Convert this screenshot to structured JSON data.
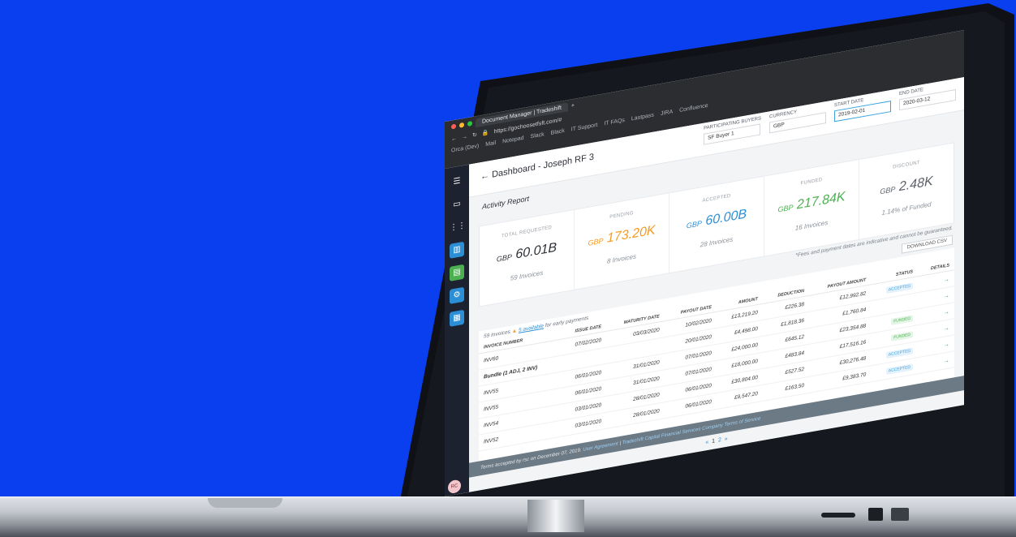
{
  "browser": {
    "tab_title": "Document Manager | Tradeshift",
    "url": "https://gochoosetfsft.com/#",
    "bookmarks": [
      "Orca (Dev)",
      "Mail",
      "Notepad",
      "Slack",
      "Black",
      "IT Support",
      "IT FAQs",
      "Lastpass",
      "JIRA",
      "Confluence"
    ]
  },
  "header": {
    "back_arrow": "←",
    "title": "Dashboard - Joseph RF 3",
    "filters": [
      {
        "label": "PARTICIPATING BUYERS",
        "value": "SF Buyer 1"
      },
      {
        "label": "CURRENCY",
        "value": "GBP"
      },
      {
        "label": "START DATE",
        "value": "2019-02-01"
      },
      {
        "label": "END DATE",
        "value": "2020-03-12"
      }
    ]
  },
  "section_title": "Activity Report",
  "cards": [
    {
      "label": "TOTAL REQUESTED",
      "currency": "GBP",
      "amount": "60.01B",
      "count": "59 Invoices",
      "color": "#2d3038"
    },
    {
      "label": "PENDING",
      "currency": "GBP",
      "amount": "173.20K",
      "count": "8 Invoices",
      "color": "#f59a23"
    },
    {
      "label": "ACCEPTED",
      "currency": "GBP",
      "amount": "60.00B",
      "count": "28 Invoices",
      "color": "#2c8fd6"
    },
    {
      "label": "FUNDED",
      "currency": "GBP",
      "amount": "217.84K",
      "count": "16 Invoices",
      "color": "#4caf50"
    },
    {
      "label": "DISCOUNT",
      "currency": "GBP",
      "amount": "2.48K",
      "count": "1.14% of Funded",
      "color": "#5b6068"
    }
  ],
  "note": "*Fees and payment dates are indicative and cannot be guaranteed.",
  "download_label": "DOWNLOAD CSV",
  "table": {
    "info_count": "59 Invoices",
    "info_link": "5 available",
    "info_suffix": "for early payments",
    "columns": [
      "INVOICE NUMBER",
      "ISSUE DATE",
      "MATURITY DATE",
      "PAYOUT DATE",
      "AMOUNT",
      "DEDUCTION",
      "PAYOUT AMOUNT",
      "STATUS",
      "DETAILS"
    ],
    "rows": [
      {
        "inv": "INV60",
        "issue": "07/02/2020",
        "maturity": "03/03/2020",
        "payout": "10/02/2020",
        "amount": "£13,219.20",
        "deduction": "£226.38",
        "payout_amount": "£12,992.82",
        "status": "ACCEPTED",
        "status_kind": "acc"
      },
      {
        "inv": "Bundle (1 ADJ, 2 INV)",
        "issue": "",
        "maturity": "",
        "payout": "20/01/2020",
        "amount": "£4,498.00",
        "deduction": "£1,818.36",
        "payout_amount": "£1,760.84",
        "status": "",
        "status_kind": ""
      },
      {
        "inv": "INV55",
        "issue": "06/01/2020",
        "maturity": "31/01/2020",
        "payout": "07/01/2020",
        "amount": "£24,000.00",
        "deduction": "£645.12",
        "payout_amount": "£23,354.88",
        "status": "FUNDED",
        "status_kind": "fun"
      },
      {
        "inv": "INV55",
        "issue": "06/01/2020",
        "maturity": "31/01/2020",
        "payout": "07/01/2020",
        "amount": "£18,000.00",
        "deduction": "£483.84",
        "payout_amount": "£17,516.16",
        "status": "FUNDED",
        "status_kind": "fun"
      },
      {
        "inv": "INV54",
        "issue": "03/01/2020",
        "maturity": "28/01/2020",
        "payout": "06/01/2020",
        "amount": "£30,804.00",
        "deduction": "£527.52",
        "payout_amount": "£30,276.48",
        "status": "ACCEPTED",
        "status_kind": "acc"
      },
      {
        "inv": "INV52",
        "issue": "03/01/2020",
        "maturity": "28/01/2020",
        "payout": "06/01/2020",
        "amount": "£9,547.20",
        "deduction": "£163.50",
        "payout_amount": "£9,383.70",
        "status": "ACCEPTED",
        "status_kind": "acc"
      }
    ]
  },
  "footer": {
    "text": "Terms accepted by rsc on December 07, 2019.",
    "link1": "User Agreement",
    "link2": "Tradeshift Capital Financial Services Company Terms of Service"
  },
  "pager": {
    "prev": "«",
    "pages": [
      "1",
      "2"
    ],
    "next": "»"
  },
  "avatar_initials": "RC",
  "colors": {
    "background": "#0a3ff0",
    "accent": "#2c8fd6",
    "funded": "#4caf50",
    "pending": "#f59a23"
  }
}
